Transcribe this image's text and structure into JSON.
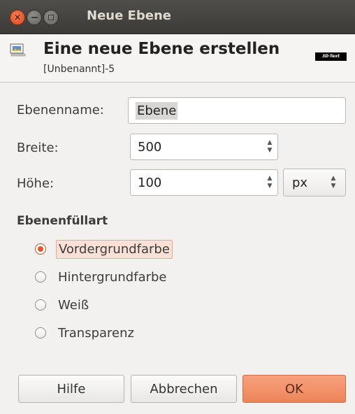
{
  "window": {
    "title": "Neue Ebene"
  },
  "header": {
    "title": "Eine neue Ebene erstellen",
    "subtitle": "[Unbenannt]-5",
    "badge": "3D-Text"
  },
  "form": {
    "name_label": "Ebenenname:",
    "name_value": "Ebene",
    "width_label": "Breite:",
    "width_value": "500",
    "height_label": "Höhe:",
    "height_value": "100",
    "unit_value": "px"
  },
  "fill": {
    "section_title": "Ebenenfüllart",
    "options": [
      {
        "label": "Vordergrundfarbe",
        "checked": true
      },
      {
        "label": "Hintergrundfarbe",
        "checked": false
      },
      {
        "label": "Weiß",
        "checked": false
      },
      {
        "label": "Transparenz",
        "checked": false
      }
    ]
  },
  "buttons": {
    "help": "Hilfe",
    "cancel": "Abbrechen",
    "ok": "OK"
  },
  "colors": {
    "accent": "#ee8459",
    "titlebar": "#3c3b37",
    "background": "#f2f1f0"
  },
  "icons": [
    "close-icon",
    "minimize-icon",
    "maximize-icon",
    "layer-icon",
    "spin-arrows-icon",
    "combo-arrows-icon"
  ]
}
